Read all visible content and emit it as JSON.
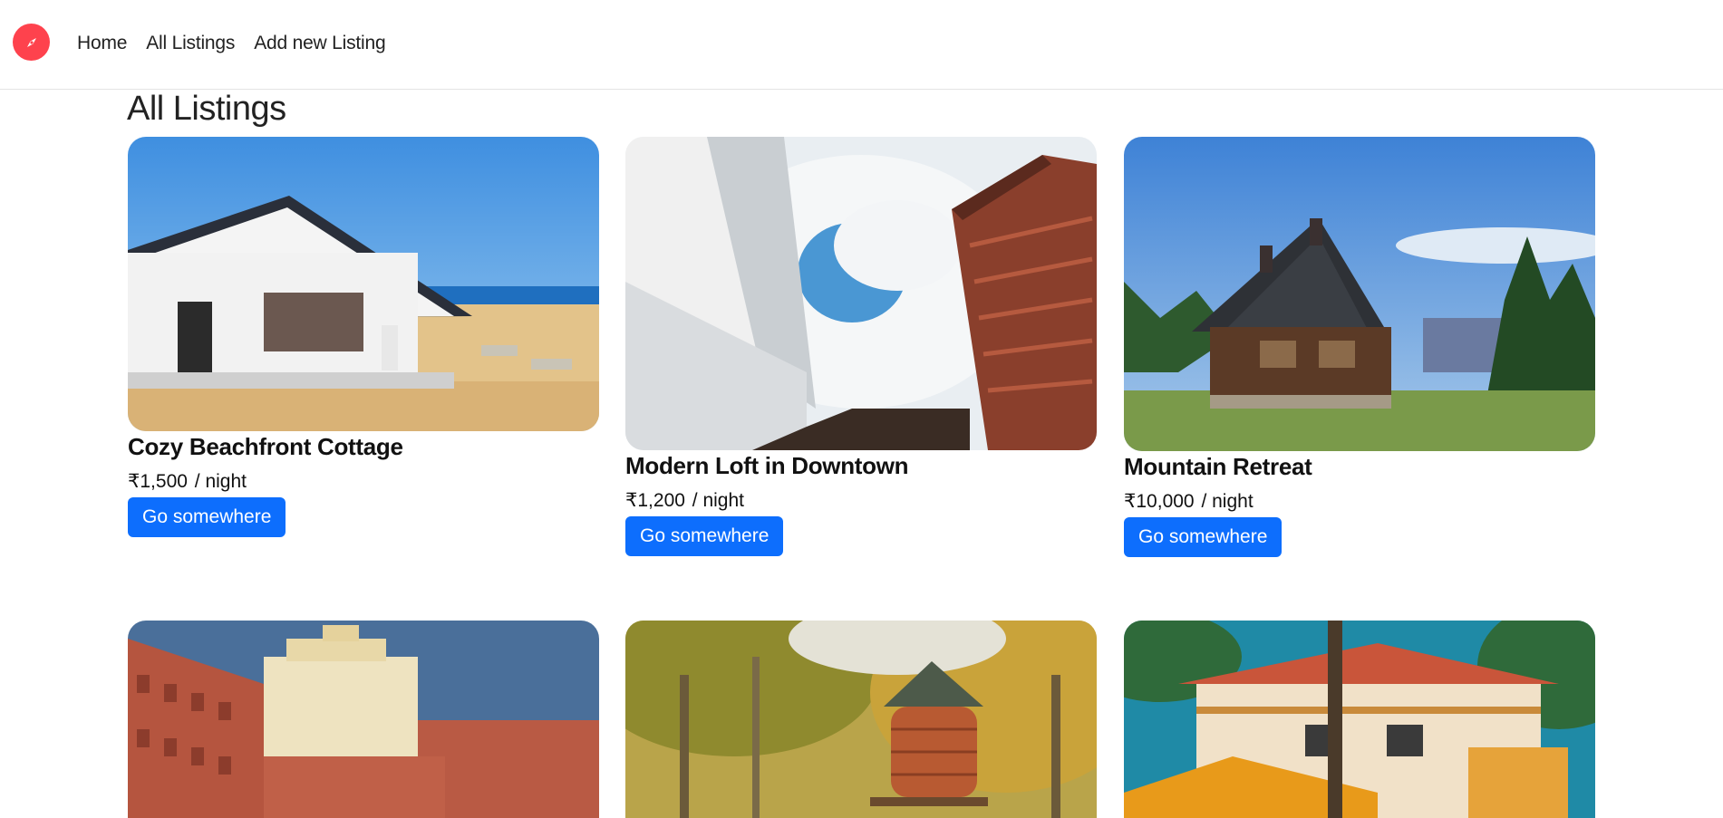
{
  "nav": {
    "links": [
      "Home",
      "All Listings",
      "Add new Listing"
    ]
  },
  "page": {
    "title": "All Listings"
  },
  "listings": [
    {
      "title": "Cozy Beachfront Cottage",
      "currency": "₹",
      "price": "1,500",
      "per": "/ night",
      "button": "Go somewhere"
    },
    {
      "title": "Modern Loft in Downtown",
      "currency": "₹",
      "price": "1,200",
      "per": "/ night",
      "button": "Go somewhere"
    },
    {
      "title": "Mountain Retreat",
      "currency": "₹",
      "price": "10,000",
      "per": "/ night",
      "button": "Go somewhere"
    },
    {
      "title": "",
      "currency": "",
      "price": "",
      "per": "",
      "button": ""
    },
    {
      "title": "",
      "currency": "",
      "price": "",
      "per": "",
      "button": ""
    },
    {
      "title": "",
      "currency": "",
      "price": "",
      "per": "",
      "button": ""
    }
  ],
  "colors": {
    "brand": "#fe424d",
    "button": "#0d6efd"
  },
  "icons": {
    "brand": "compass-icon"
  }
}
